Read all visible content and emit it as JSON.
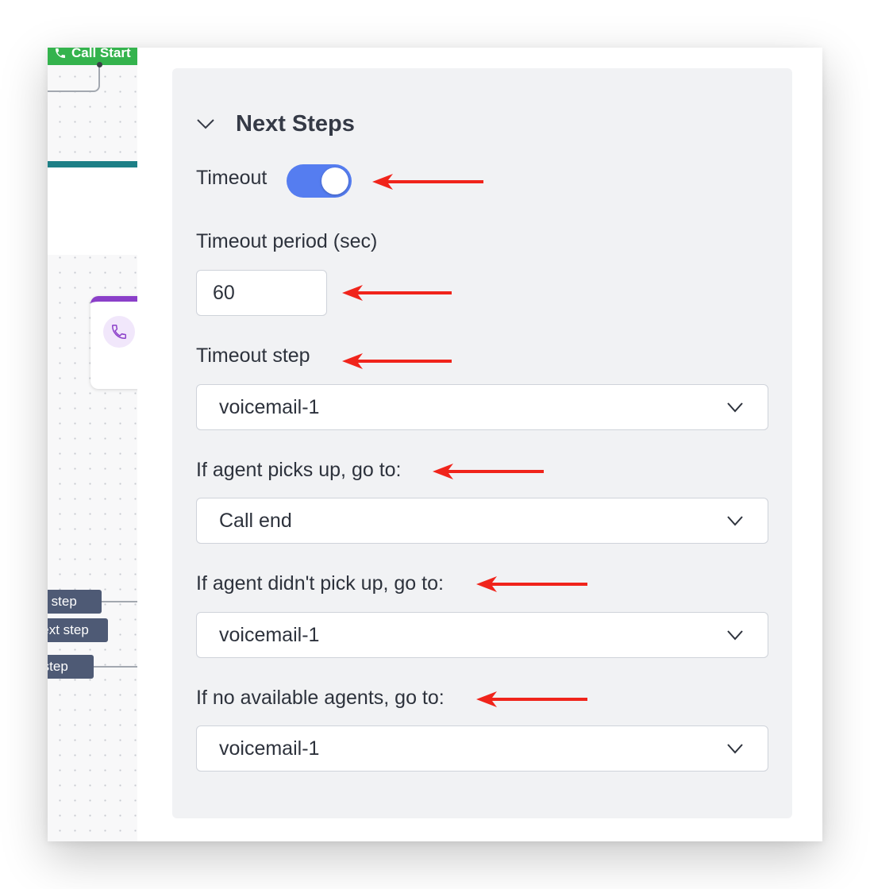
{
  "canvas": {
    "start_node_label": "Call Start",
    "tags": [
      "Next step",
      "Next step",
      "Next step"
    ]
  },
  "section": {
    "title": "Next Steps"
  },
  "timeout": {
    "label": "Timeout",
    "enabled": true
  },
  "timeout_period": {
    "label": "Timeout period (sec)",
    "value": "60"
  },
  "timeout_step": {
    "label": "Timeout step",
    "selected": "voicemail-1"
  },
  "agent_picks_up": {
    "label": "If agent picks up, go to:",
    "selected": "Call end"
  },
  "agent_no_pickup": {
    "label": "If agent didn't pick up, go to:",
    "selected": "voicemail-1"
  },
  "no_agents": {
    "label": "If no available agents, go to:",
    "selected": "voicemail-1"
  },
  "colors": {
    "accent": "#557df0",
    "annotation_arrow": "#f0241b",
    "start_node": "#34b34d",
    "voice_node": "#8b3fc9",
    "tag": "#4e5a75"
  }
}
